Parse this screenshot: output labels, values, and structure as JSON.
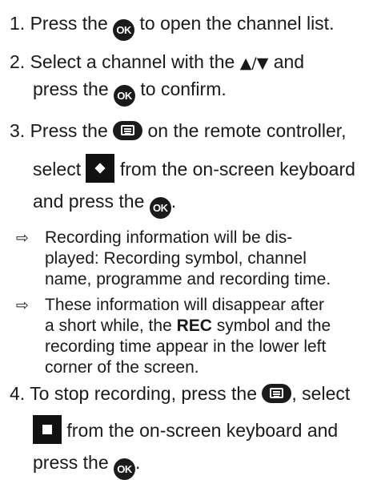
{
  "steps": [
    {
      "num": "1.",
      "a": "Press the",
      "b": "to open the channel list."
    },
    {
      "num": "2.",
      "a": "Select a channel with the",
      "arrows": "▲/▼",
      "b": "and",
      "c": "press the",
      "d": "to confirm."
    },
    {
      "num": "3.",
      "a": "Press the",
      "b": "on the remote controller,",
      "c": "select",
      "d": "from the on-screen keyboard",
      "e": "and press the",
      "f": "."
    },
    {
      "num": "4.",
      "a": "To stop recording, press the",
      "b": ", select",
      "c": "from the on-screen keyboard and",
      "d": "press the",
      "e": "."
    }
  ],
  "results": [
    {
      "arrow": "⇨",
      "lines": [
        "Recording information will be dis-",
        "played: Recording symbol, channel",
        "name, programme and recording time."
      ]
    },
    {
      "arrow": "⇨",
      "l1": "These information will disappear after",
      "l2a": "a short while, the",
      "l2bold": "REC",
      "l2b": "symbol and the",
      "l3": "recording time appear in the lower left",
      "l4": "corner of the screen."
    }
  ],
  "icons": {
    "ok_label": "OK",
    "ok": "ok-button-icon",
    "keyboard": "keyboard-button-icon",
    "record": "record-symbol-icon",
    "stop": "stop-symbol-icon"
  }
}
